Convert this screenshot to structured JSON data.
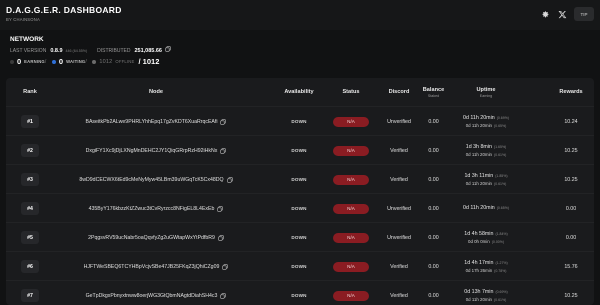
{
  "header": {
    "title": "D.A.G.G.E.R. DASHBOARD",
    "subtitle": "BY CHAINSONA",
    "tip_label": "TIP",
    "icons": [
      "gear-icon",
      "x-logo-icon"
    ]
  },
  "network": {
    "title": "NETWORK",
    "last_version_label": "LAST VERSION",
    "last_version": "0.8.9",
    "last_version_stats": "446 (64.55%)",
    "distributed_label": "DISTRIBUTED",
    "distributed_value": "251,085.66",
    "earning_count": "0",
    "earning_label": "EARNING",
    "waiting_count": "0",
    "waiting_label": "WAITING",
    "offline_count": "1012",
    "offline_label": "OFFLINE",
    "total_text": "/ 1012",
    "colors": {
      "earning": "#3a3a3a",
      "waiting": "#2f6fd6",
      "offline": "#6b6b6b"
    }
  },
  "table": {
    "headers": {
      "rank": "Rank",
      "node": "Node",
      "availability": "Availability",
      "status": "Status",
      "discord": "Discord",
      "balance": "Balance",
      "balance_sub": "Staked",
      "uptime": "Uptime",
      "uptime_sub": "Earning",
      "rewards": "Rewards"
    },
    "rows": [
      {
        "rank": "#1",
        "node": "BAseitkPb2ALwe9PHRLYhhEpq17gZvKDT6XuaRrqcEAfi",
        "availability": "DOWN",
        "status": "N/A",
        "discord": "Unverified",
        "balance": "0.00",
        "uptime": "0d 11h 20min",
        "uptime_pct": "(0.69%)",
        "earning": "0d 11h 20min",
        "earning_pct": "(0.65%)",
        "rewards": "10.24"
      },
      {
        "rank": "#2",
        "node": "DxgiFY1Xc9jDjLXNgMnDEHC2JY1QiqGRrpRzH92iHkNx",
        "availability": "DOWN",
        "status": "N/A",
        "discord": "Verified",
        "balance": "0.00",
        "uptime": "1d 3h 8min",
        "uptime_pct": "(1.65%)",
        "earning": "0d 11h 20min",
        "earning_pct": "(0.61%)",
        "rewards": "10.25"
      },
      {
        "rank": "#3",
        "node": "8wD9dCECWX6tEd9cMeNyMyw45LBm39uWGqTcK5Cx48DQ",
        "availability": "DOWN",
        "status": "N/A",
        "discord": "Verified",
        "balance": "0.00",
        "uptime": "1d 3h 11min",
        "uptime_pct": "(1.85%)",
        "earning": "0d 11h 20min",
        "earning_pct": "(0.61%)",
        "rewards": "10.25"
      },
      {
        "rank": "#4",
        "node": "435ByY176kbzzKtZZwuc3tCvRyrzcc8NFigEL8L4ExEb",
        "availability": "DOWN",
        "status": "N/A",
        "discord": "Unverified",
        "balance": "0.00",
        "uptime": "0d 11h 20min",
        "uptime_pct": "(0.65%)",
        "earning": "",
        "earning_pct": "",
        "rewards": "0.00"
      },
      {
        "rank": "#5",
        "node": "2PqgsvRV59ucNabr5oaQqvfyZg2uGWtapWxYtPdfbR9",
        "availability": "DOWN",
        "status": "N/A",
        "discord": "Unverified",
        "balance": "0.00",
        "uptime": "1d 4h 58min",
        "uptime_pct": "(1.84%)",
        "earning": "0d 0h 0min",
        "earning_pct": "(0.00%)",
        "rewards": "0.00"
      },
      {
        "rank": "#6",
        "node": "HJFTWeSBEQ6TCYHBpVcjvSBe47JB25FKqZ3jQhiCZg09",
        "availability": "DOWN",
        "status": "N/A",
        "discord": "Verified",
        "balance": "0.00",
        "uptime": "1d 4h 17min",
        "uptime_pct": "(1.27%)",
        "earning": "0d 17h 26min",
        "earning_pct": "(0.78%)",
        "rewards": "15.76"
      },
      {
        "rank": "#7",
        "node": "GeTpDkgxPbnyxtnww8oerjWG3GtQbmNAgtdDiahSH4c3",
        "availability": "DOWN",
        "status": "N/A",
        "discord": "Verified",
        "balance": "0.00",
        "uptime": "0d 13h 7min",
        "uptime_pct": "(0.69%)",
        "earning": "0d 11h 20min",
        "earning_pct": "(0.61%)",
        "rewards": "10.25"
      }
    ]
  }
}
